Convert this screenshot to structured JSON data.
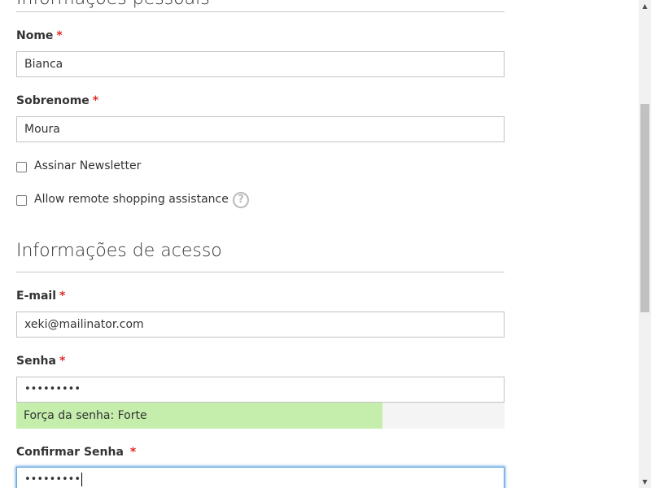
{
  "form": {
    "personal": {
      "section_title": "Informações pessoais",
      "first_name": {
        "label": "Nome",
        "required_mark": "*",
        "value": "Bianca"
      },
      "last_name": {
        "label": "Sobrenome",
        "required_mark": "*",
        "value": "Moura"
      },
      "newsletter": {
        "label": "Assinar Newsletter",
        "checked": false
      },
      "remote_assistance": {
        "label": "Allow remote shopping assistance",
        "checked": false,
        "help_glyph": "?"
      }
    },
    "access": {
      "section_title": "Informações de acesso",
      "email": {
        "label": "E-mail",
        "required_mark": "*",
        "value": "xeki@mailinator.com"
      },
      "password": {
        "label": "Senha",
        "required_mark": "*",
        "masked_value": "•••••••••",
        "strength_text": "Força da senha: Forte",
        "strength_fraction": 0.75
      },
      "confirm_password": {
        "label": "Confirmar Senha",
        "required_mark": "*",
        "masked_value": "•••••••••"
      }
    }
  },
  "icons": {
    "help": "question-circle-icon",
    "scroll_up": "chevron-up-icon",
    "scroll_down": "chevron-down-icon"
  },
  "colors": {
    "required": "#e02b27",
    "strength_fill": "#c5eeac",
    "strength_track": "#f4f4f4",
    "focus_border": "#68a8e0"
  },
  "scrollbar": {
    "up_glyph": "▲",
    "down_glyph": "▼"
  }
}
